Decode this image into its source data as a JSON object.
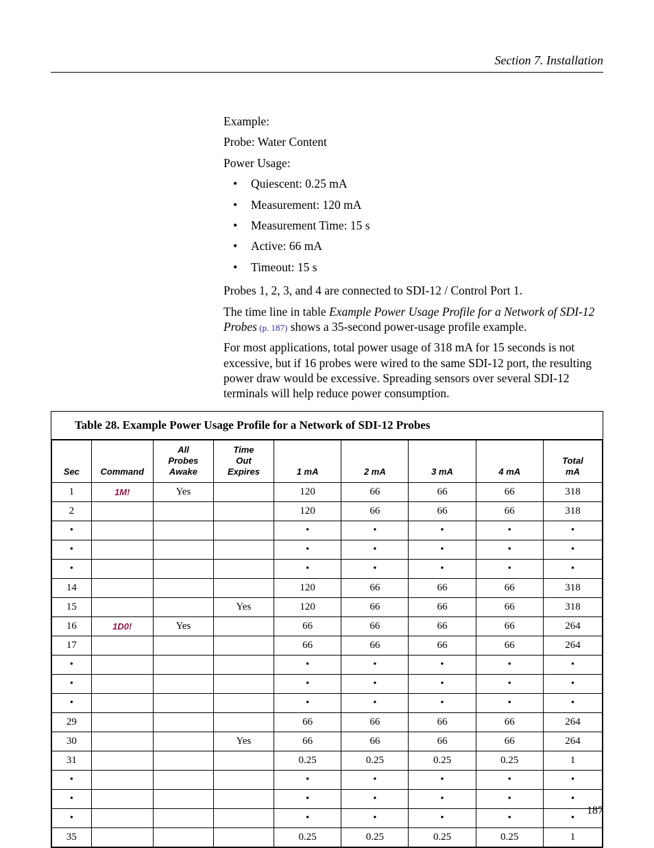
{
  "header": {
    "section": "Section 7.  Installation"
  },
  "body": {
    "example_label": "Example:",
    "probe_line": "Probe: Water Content",
    "power_usage_label": "Power Usage:",
    "bullets": [
      "Quiescent: 0.25 mA",
      "Measurement: 120 mA",
      "Measurement Time: 15 s",
      "Active: 66 mA",
      "Timeout: 15 s"
    ],
    "probes_line": "Probes 1, 2, 3, and 4 are connected to SDI-12 / Control Port 1.",
    "timeline_pre": "The time line in table ",
    "timeline_em": "Example Power Usage Profile for a Network of SDI-12 Probes",
    "timeline_ref": " (p. 187)",
    "timeline_post": " shows a 35-second power-usage profile example.",
    "para3": "For most applications, total power usage of 318 mA for 15 seconds is not excessive, but if 16 probes were wired to the same SDI-12 port, the resulting power draw would be excessive. Spreading sensors over several SDI-12 terminals will help reduce power consumption."
  },
  "table": {
    "title": "Table 28. Example Power Usage Profile for a Network of SDI-12 Probes",
    "headers": {
      "sec": "Sec",
      "command": "Command",
      "all_probes_awake": "All\nProbes\nAwake",
      "timeout_expires": "Time\nOut\nExpires",
      "m1": "1 mA",
      "m2": "2 mA",
      "m3": "3 mA",
      "m4": "4 mA",
      "total": "Total\nmA"
    },
    "rows": [
      {
        "sec": "1",
        "command": "1M!",
        "awake": "Yes",
        "expires": "",
        "m1": "120",
        "m2": "66",
        "m3": "66",
        "m4": "66",
        "total": "318"
      },
      {
        "sec": "2",
        "command": "",
        "awake": "",
        "expires": "",
        "m1": "120",
        "m2": "66",
        "m3": "66",
        "m4": "66",
        "total": "318"
      },
      {
        "sec": "•",
        "command": "",
        "awake": "",
        "expires": "",
        "m1": "•",
        "m2": "•",
        "m3": "•",
        "m4": "•",
        "total": "•"
      },
      {
        "sec": "•",
        "command": "",
        "awake": "",
        "expires": "",
        "m1": "•",
        "m2": "•",
        "m3": "•",
        "m4": "•",
        "total": "•"
      },
      {
        "sec": "•",
        "command": "",
        "awake": "",
        "expires": "",
        "m1": "•",
        "m2": "•",
        "m3": "•",
        "m4": "•",
        "total": "•"
      },
      {
        "sec": "14",
        "command": "",
        "awake": "",
        "expires": "",
        "m1": "120",
        "m2": "66",
        "m3": "66",
        "m4": "66",
        "total": "318"
      },
      {
        "sec": "15",
        "command": "",
        "awake": "",
        "expires": "Yes",
        "m1": "120",
        "m2": "66",
        "m3": "66",
        "m4": "66",
        "total": "318"
      },
      {
        "sec": "16",
        "command": "1D0!",
        "awake": "Yes",
        "expires": "",
        "m1": "66",
        "m2": "66",
        "m3": "66",
        "m4": "66",
        "total": "264"
      },
      {
        "sec": "17",
        "command": "",
        "awake": "",
        "expires": "",
        "m1": "66",
        "m2": "66",
        "m3": "66",
        "m4": "66",
        "total": "264"
      },
      {
        "sec": "•",
        "command": "",
        "awake": "",
        "expires": "",
        "m1": "•",
        "m2": "•",
        "m3": "•",
        "m4": "•",
        "total": "•"
      },
      {
        "sec": "•",
        "command": "",
        "awake": "",
        "expires": "",
        "m1": "•",
        "m2": "•",
        "m3": "•",
        "m4": "•",
        "total": "•"
      },
      {
        "sec": "•",
        "command": "",
        "awake": "",
        "expires": "",
        "m1": "•",
        "m2": "•",
        "m3": "•",
        "m4": "•",
        "total": "•"
      },
      {
        "sec": "29",
        "command": "",
        "awake": "",
        "expires": "",
        "m1": "66",
        "m2": "66",
        "m3": "66",
        "m4": "66",
        "total": "264"
      },
      {
        "sec": "30",
        "command": "",
        "awake": "",
        "expires": "Yes",
        "m1": "66",
        "m2": "66",
        "m3": "66",
        "m4": "66",
        "total": "264"
      },
      {
        "sec": "31",
        "command": "",
        "awake": "",
        "expires": "",
        "m1": "0.25",
        "m2": "0.25",
        "m3": "0.25",
        "m4": "0.25",
        "total": "1"
      },
      {
        "sec": "•",
        "command": "",
        "awake": "",
        "expires": "",
        "m1": "•",
        "m2": "•",
        "m3": "•",
        "m4": "•",
        "total": "•"
      },
      {
        "sec": "•",
        "command": "",
        "awake": "",
        "expires": "",
        "m1": "•",
        "m2": "•",
        "m3": "•",
        "m4": "•",
        "total": "•"
      },
      {
        "sec": "•",
        "command": "",
        "awake": "",
        "expires": "",
        "m1": "•",
        "m2": "•",
        "m3": "•",
        "m4": "•",
        "total": "•"
      },
      {
        "sec": "35",
        "command": "",
        "awake": "",
        "expires": "",
        "m1": "0.25",
        "m2": "0.25",
        "m3": "0.25",
        "m4": "0.25",
        "total": "1"
      }
    ]
  },
  "footer": {
    "page_number": "187"
  }
}
